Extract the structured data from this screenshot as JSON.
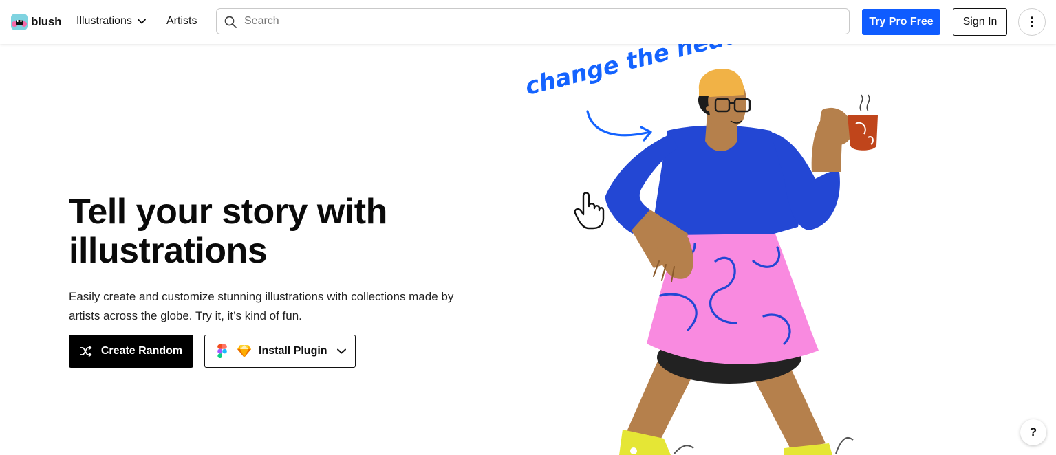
{
  "nav": {
    "logo_text": "blush",
    "illustrations_label": "Illustrations",
    "artists_label": "Artists",
    "search_placeholder": "Search",
    "try_pro_label": "Try Pro Free",
    "sign_in_label": "Sign In",
    "more_icon": "vertical-dots-icon"
  },
  "hero": {
    "title": "Tell your story with illustrations",
    "subtitle": "Easily create and customize stunning illustrations with collections made by artists across the globe. Try it, it’s kind of fun.",
    "create_random_label": "Create Random",
    "install_plugin_label": "Install Plugin",
    "plugin_icons": [
      "figma-icon",
      "sketch-icon"
    ],
    "illustration_caption": "change the head"
  },
  "help_label": "?",
  "colors": {
    "accent": "#0f5cff",
    "primary_button": "#000000",
    "illustration_blue": "#2347d4",
    "illustration_pink": "#f98ae0",
    "illustration_skin": "#b5804c",
    "illustration_hat": "#f1b246",
    "annotation": "#1463ff"
  }
}
